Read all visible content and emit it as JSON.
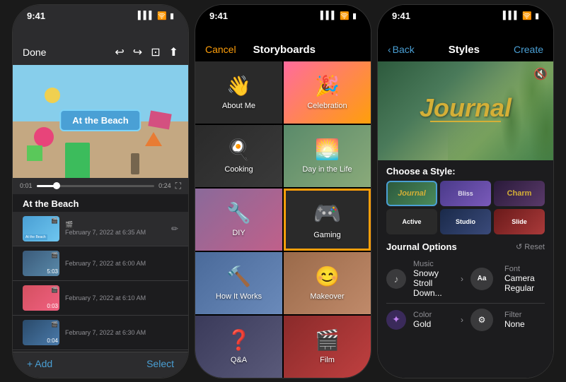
{
  "phones": [
    {
      "id": "phone1",
      "statusTime": "9:41",
      "topbar": {
        "backLabel": "Done",
        "icons": [
          "↩",
          "↪",
          "⊡",
          "⬆"
        ]
      },
      "videoTitle": "At the Beach",
      "timeStart": "0:01",
      "timeEnd": "0:24",
      "projectTitle": "At the Beach",
      "clips": [
        {
          "id": 1,
          "icon": "🎬",
          "date": "February 7, 2022 at 6:35 AM",
          "active": true
        },
        {
          "id": 2,
          "duration": "5:03",
          "date": "February 7, 2022 at 6:00 AM",
          "active": false
        },
        {
          "id": 3,
          "duration": "0:03",
          "date": "February 7, 2022 at 6:10 AM",
          "active": false
        },
        {
          "id": 4,
          "duration": "0:04",
          "date": "February 7, 2022 at 6:30 AM",
          "active": false
        },
        {
          "id": 5,
          "duration": "",
          "date": "",
          "active": false
        }
      ],
      "bottomBar": {
        "addLabel": "+ Add",
        "selectLabel": "Select"
      }
    },
    {
      "id": "phone2",
      "statusTime": "9:41",
      "topbar": {
        "cancelLabel": "Cancel",
        "title": "Storyboards"
      },
      "storyboards": [
        {
          "id": 1,
          "label": "About Me",
          "icon": "👋",
          "bg": "sb-bg-1"
        },
        {
          "id": 2,
          "label": "Celebration",
          "icon": "🎉",
          "bg": "sb-bg-2"
        },
        {
          "id": 3,
          "label": "Cooking",
          "icon": "🍳",
          "bg": "sb-bg-3"
        },
        {
          "id": 4,
          "label": "Day in the Life",
          "icon": "🌅",
          "bg": "sb-bg-4"
        },
        {
          "id": 5,
          "label": "DIY",
          "icon": "🔧",
          "bg": "sb-bg-5"
        },
        {
          "id": 6,
          "label": "Gaming",
          "icon": "🎮",
          "bg": "sb-bg-6",
          "active": true
        },
        {
          "id": 7,
          "label": "How It Works",
          "icon": "🔨",
          "bg": "sb-bg-7"
        },
        {
          "id": 8,
          "label": "Makeover",
          "icon": "😊",
          "bg": "sb-bg-8"
        },
        {
          "id": 9,
          "label": "Q&A",
          "icon": "❓",
          "bg": "sb-bg-9"
        },
        {
          "id": 10,
          "label": "Film",
          "icon": "🎬",
          "bg": "sb-bg-10"
        }
      ]
    },
    {
      "id": "phone3",
      "statusTime": "9:41",
      "topbar": {
        "backLabel": "Back",
        "title": "Styles",
        "createLabel": "Create"
      },
      "journalTitle": "Journal",
      "chooseStyleLabel": "Choose a Style:",
      "styles": [
        {
          "id": 1,
          "label": "Journal",
          "cls": "style-journal",
          "selected": true
        },
        {
          "id": 2,
          "label": "Bliss",
          "cls": "style-bliss",
          "selected": false
        },
        {
          "id": 3,
          "label": "Charm",
          "cls": "style-charm",
          "selected": false
        },
        {
          "id": 4,
          "label": "Active",
          "cls": "style-active",
          "selected": false
        },
        {
          "id": 5,
          "label": "Studio",
          "cls": "style-studio",
          "selected": false
        },
        {
          "id": 6,
          "label": "Slide",
          "cls": "style-slide",
          "selected": false
        }
      ],
      "journalOptionsLabel": "Journal Options",
      "resetLabel": "↺ Reset",
      "options": [
        {
          "id": 1,
          "icon": "♪",
          "title": "Music",
          "value": "Snowy Stroll Down...",
          "rightType": "chevron"
        },
        {
          "id": 2,
          "icon": "Aa",
          "title": "Font",
          "value": "Camera Regular",
          "rightType": "icon",
          "rightIcon": "Aa"
        },
        {
          "id": 3,
          "icon": "🎨",
          "title": "Color",
          "value": "Gold",
          "rightType": "chevron"
        },
        {
          "id": 4,
          "icon": "⚙",
          "title": "Filter",
          "value": "None",
          "rightType": "icon",
          "rightIcon": "⚙"
        }
      ]
    }
  ]
}
